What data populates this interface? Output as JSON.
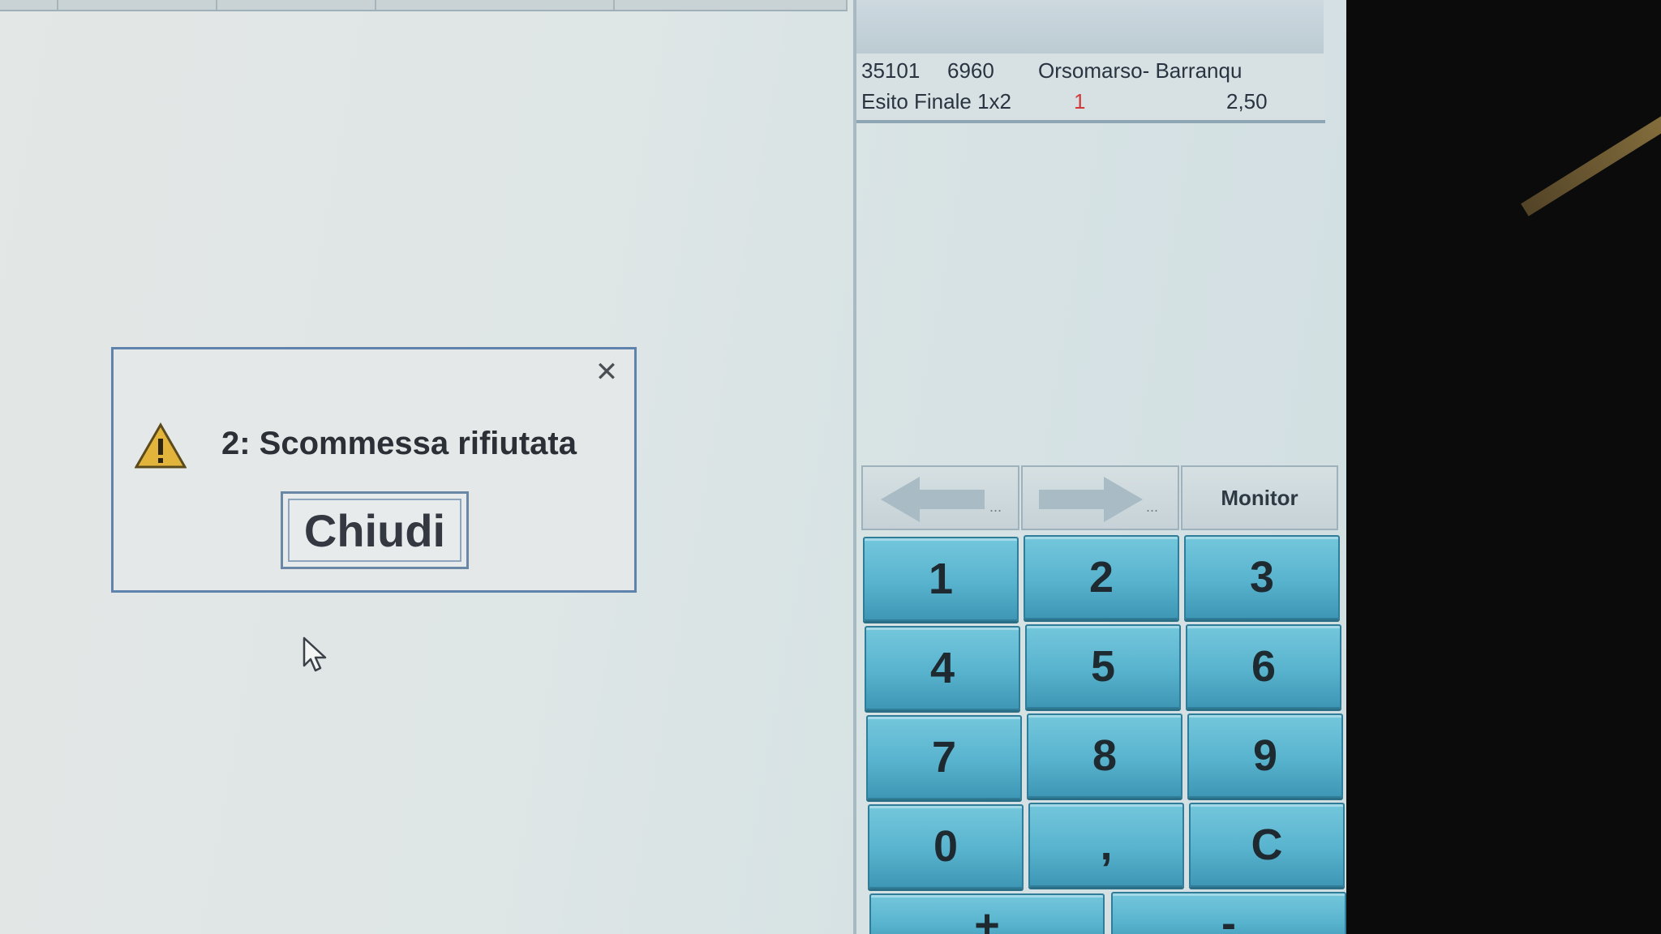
{
  "bet_slip": {
    "event_code": "35101",
    "event_number": "6960",
    "match": "Orsomarso- Barranqu",
    "market": "Esito Finale 1x2",
    "selection": "1",
    "odds": "2,50"
  },
  "dialog": {
    "message": "2: Scommessa rifiutata",
    "close_button": "Chiudi",
    "close_icon": "close-icon",
    "warning_icon": "warning-icon"
  },
  "nav": {
    "back_dots": "...",
    "forward_dots": "...",
    "monitor": "Monitor"
  },
  "keypad": {
    "keys": [
      "1",
      "2",
      "3",
      "4",
      "5",
      "6",
      "7",
      "8",
      "9",
      "0",
      ",",
      "C",
      "+",
      "-"
    ]
  },
  "colors": {
    "key_blue": "#58b3ce",
    "dialog_border": "#5f83ad",
    "selection_red": "#d23a3a"
  }
}
